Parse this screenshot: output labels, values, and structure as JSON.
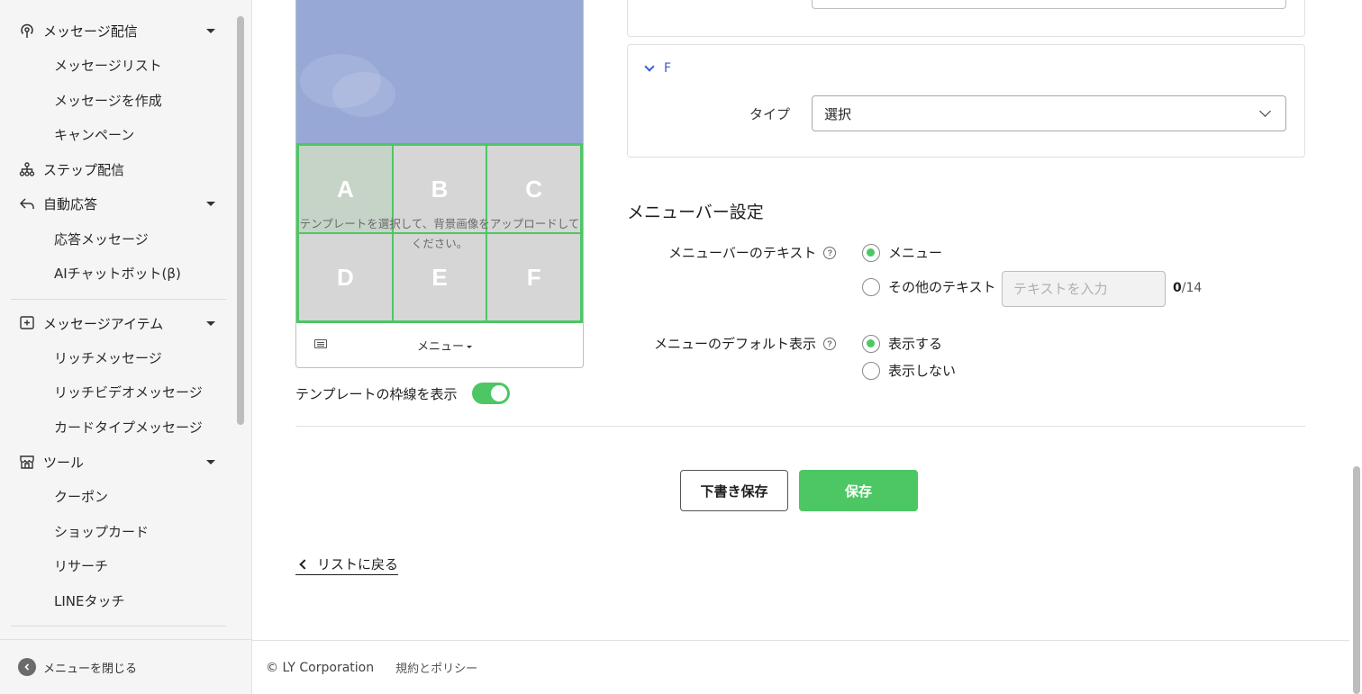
{
  "sidebar": {
    "items": [
      {
        "label": "メッセージ配信",
        "icon": "broadcast-icon",
        "expandable": true
      },
      {
        "label": "メッセージリスト"
      },
      {
        "label": "メッセージを作成"
      },
      {
        "label": "キャンペーン"
      },
      {
        "label": "ステップ配信",
        "icon": "step-flow-icon"
      },
      {
        "label": "自動応答",
        "icon": "reply-icon",
        "expandable": true
      },
      {
        "label": "応答メッセージ"
      },
      {
        "label": "AIチャットボット(β)"
      },
      {
        "label": "メッセージアイテム",
        "icon": "add-box-icon",
        "expandable": true
      },
      {
        "label": "リッチメッセージ"
      },
      {
        "label": "リッチビデオメッセージ"
      },
      {
        "label": "カードタイプメッセージ"
      },
      {
        "label": "ツール",
        "icon": "shop-icon",
        "expandable": true
      },
      {
        "label": "クーポン"
      },
      {
        "label": "ショップカード"
      },
      {
        "label": "リサーチ"
      },
      {
        "label": "LINEタッチ"
      }
    ],
    "close_menu": "メニューを閉じる"
  },
  "preview": {
    "cells": [
      "A",
      "B",
      "C",
      "D",
      "E",
      "F"
    ],
    "note": "テンプレートを選択して、背景画像をアップロードしてください。",
    "menu_label": "メニュー"
  },
  "template_border": {
    "label": "テンプレートの枠線を表示",
    "enabled": true
  },
  "area_f": {
    "title": "F",
    "type_label": "タイプ",
    "type_value": "選択"
  },
  "menubar": {
    "title": "メニューバー設定",
    "text_label": "メニューバーのテキスト",
    "text_options": [
      "メニュー",
      "その他のテキスト"
    ],
    "text_selected": "メニュー",
    "custom_placeholder": "テキストを入力",
    "counter_current": "0",
    "counter_max": "/14",
    "default_label": "メニューのデフォルト表示",
    "default_options": [
      "表示する",
      "表示しない"
    ],
    "default_selected": "表示する"
  },
  "actions": {
    "draft": "下書き保存",
    "save": "保存"
  },
  "back_link": "リストに戻る",
  "footer": {
    "copyright": "© LY Corporation",
    "policy": "規約とポリシー"
  },
  "colors": {
    "accent": "#4cc764",
    "link": "#3d5bd6",
    "preview_bg": "#97a8d6"
  }
}
